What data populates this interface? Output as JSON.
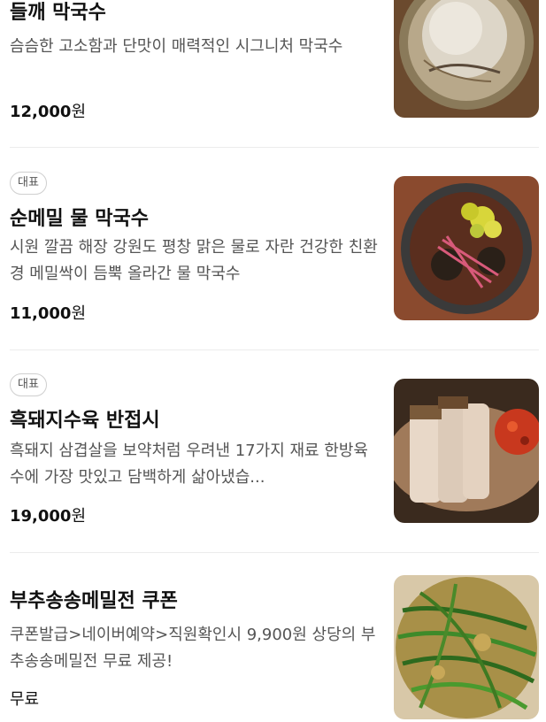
{
  "menu": {
    "items": [
      {
        "badge": "",
        "name": "들깨 막국수",
        "description": "슴슴한 고소함과 단맛이 매력적인 시그니처 막국수",
        "price_number": "12,000",
        "price_unit": "원",
        "image_icon": "perilla-noodle-photo"
      },
      {
        "badge": "대표",
        "name": "순메밀 물 막국수",
        "description": "시원 깔끔 해장 강원도 평창 맑은 물로 자란 건강한 친환경 메밀싹이 듬뿍 올라간 물 막국수",
        "price_number": "11,000",
        "price_unit": "원",
        "image_icon": "cold-buckwheat-noodle-photo"
      },
      {
        "badge": "대표",
        "name": "흑돼지수육 반접시",
        "description": "흑돼지 삼겹살을 보약처럼 우려낸 17가지 재료 한방육수에 가장 맛있고 담백하게 삶아냈습...",
        "price_number": "19,000",
        "price_unit": "원",
        "image_icon": "boiled-pork-photo"
      },
      {
        "badge": "",
        "name": "부추송송메밀전 쿠폰",
        "description": "쿠폰발급>네이버예약>직원확인시 9,900원 상당의 부추송송메밀전 무료 제공!",
        "price_text": "무료",
        "image_icon": "chive-pancake-photo"
      }
    ]
  },
  "colors": {
    "badge_border": "#cfcfcf",
    "description": "#555555",
    "title": "#111111",
    "divider": "#ececec"
  }
}
